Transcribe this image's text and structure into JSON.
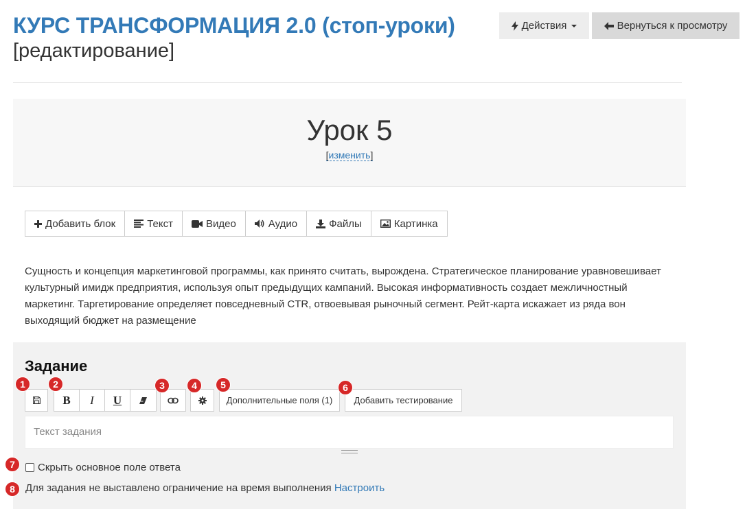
{
  "header": {
    "title": "КУРС ТРАНСФОРМАЦИЯ 2.0 (стоп-уроки)",
    "subtitle": "[редактирование]",
    "actions_label": "Действия",
    "back_label": "Вернуться к просмотру"
  },
  "lesson": {
    "title": "Урок 5",
    "edit_label": "изменить"
  },
  "block_toolbar": {
    "add_block": "Добавить блок",
    "text": "Текст",
    "video": "Видео",
    "audio": "Аудио",
    "files": "Файлы",
    "image": "Картинка"
  },
  "description": "Сущность и концепция маркетинговой программы, как принято считать, вырождена. Стратегическое планирование уравновешивает культурный имидж предприятия, используя опыт предыдущих кампаний. Высокая информативность создает межличностный маркетинг. Таргетирование определяет повседневный CTR, отвоевывая рыночный сегмент. Рейт-карта искажает из ряда вон выходящий бюджет на размещение",
  "task": {
    "title": "Задание",
    "bold": "B",
    "italic": "I",
    "underline": "U",
    "extra_fields": "Дополнительные поля (1)",
    "add_testing": "Добавить тестирование",
    "editor_placeholder": "Текст задания",
    "hide_answer_label": "Скрыть основное поле ответа",
    "limit_text": "Для задания не выставлено ограничение на время выполнения",
    "limit_link": "Настроить"
  },
  "badges": [
    "1",
    "2",
    "3",
    "4",
    "5",
    "6",
    "7",
    "8"
  ],
  "colors": {
    "title_blue": "#337ab7",
    "badge_red": "#d62828",
    "panel_bg": "#f2f2f2"
  }
}
